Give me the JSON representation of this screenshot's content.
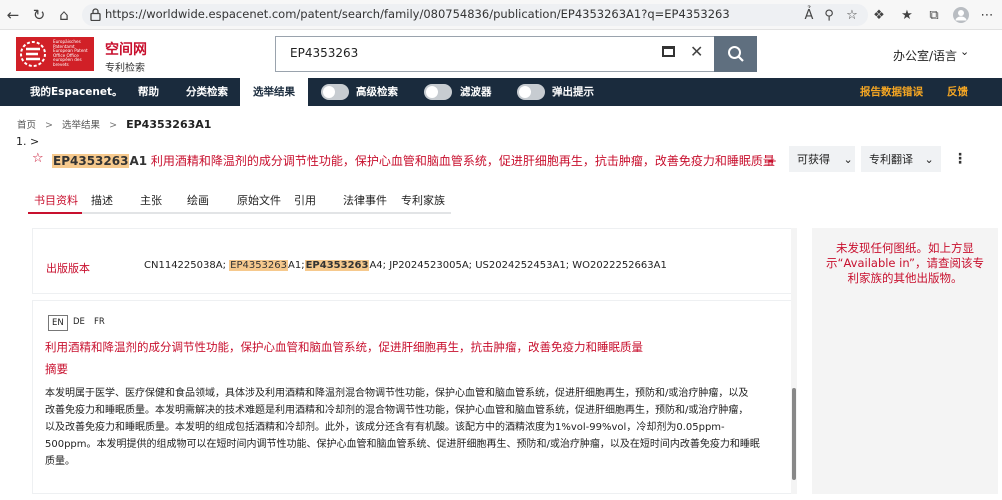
{
  "browser": {
    "url": "https://worldwide.espacenet.com/patent/search/family/080754836/publication/EP4353263A1?q=EP4353263"
  },
  "header": {
    "logo_text": "Europäisches Patentamt European Patent Office Office européen des brevets",
    "brand_title": "空间网",
    "brand_subtitle": "专利检索",
    "search_value": "EP4353263",
    "office_language": "办公室/语言"
  },
  "navbar": {
    "items": [
      "我的Espacenet。",
      "帮助",
      "分类检索",
      "选举结果"
    ],
    "toggles": [
      "高级检索",
      "滤波器",
      "弹出提示"
    ],
    "report_error": "报告数据错误",
    "feedback": "反馈"
  },
  "breadcrumb": {
    "home": "首页",
    "results": "选举结果",
    "current": "EP4353263A1"
  },
  "result_index": "1.",
  "document": {
    "number_hl": "EP4353263",
    "number_suffix": "A1",
    "title": "利用酒精和降温剂的成分调节性功能，保护心血管和脑血管系统，促进肝细胞再生，抗击肿瘤，改善免疫力和睡眠质量",
    "plus": "+",
    "availability_label": "可获得",
    "translate_label": "专利翻译"
  },
  "tabs": [
    "书目资料",
    "描述",
    "主张",
    "绘画",
    "原始文件",
    "引用",
    "法律事件",
    "专利家族"
  ],
  "publication": {
    "label": "出版版本",
    "p1": "CN114225038A; ",
    "p2_hl": "EP4353263",
    "p2_suffix": "A1;",
    "p3_hl": "EP4353263",
    "p3_suffix": "A4; JP2024523005A; US2024252453A1; WO2022252663A1"
  },
  "abstract": {
    "languages": [
      "EN",
      "DE",
      "FR"
    ],
    "title": "利用酒精和降温剂的成分调节性功能，保护心血管和脑血管系统，促进肝细胞再生，抗击肿瘤，改善免疫力和睡眠质量",
    "heading": "摘要",
    "lines": [
      "本发明属于医学、医疗保健和食品领域，具体涉及利用酒精和降温剂混合物调节性功能，保护心血管和脑血管系统，促进肝细胞再生，预防和/或治疗肿瘤，以及",
      "改善免疫力和睡眠质量。本发明需解决的技术难题是利用酒精和冷却剂的混合物调节性功能，保护心血管和脑血管系统，促进肝细胞再生，预防和/或治疗肿瘤，",
      "以及改善免疫力和睡眠质量。本发明的组成包括酒精和冷却剂。此外，该成分还含有有机酸。该配方中的酒精浓度为1%vol-99%vol，冷却剂为0.05ppm-",
      "500ppm。本发明提供的组成物可以在短时间内调节性功能、保护心血管和脑血管系统、促进肝细胞再生、预防和/或治疗肿瘤，以及在短时间内改善免疫力和睡眠",
      "质量。"
    ]
  },
  "side_panel": {
    "message": "未发现任何图纸。如上方显示“Available in”，请查阅该专利家族的其他出版物。"
  },
  "colors": {
    "brand_red": "#c8102e",
    "navbar": "#1a2b3d",
    "highlight": "#f6c98d",
    "link_orange": "#f5a623"
  }
}
